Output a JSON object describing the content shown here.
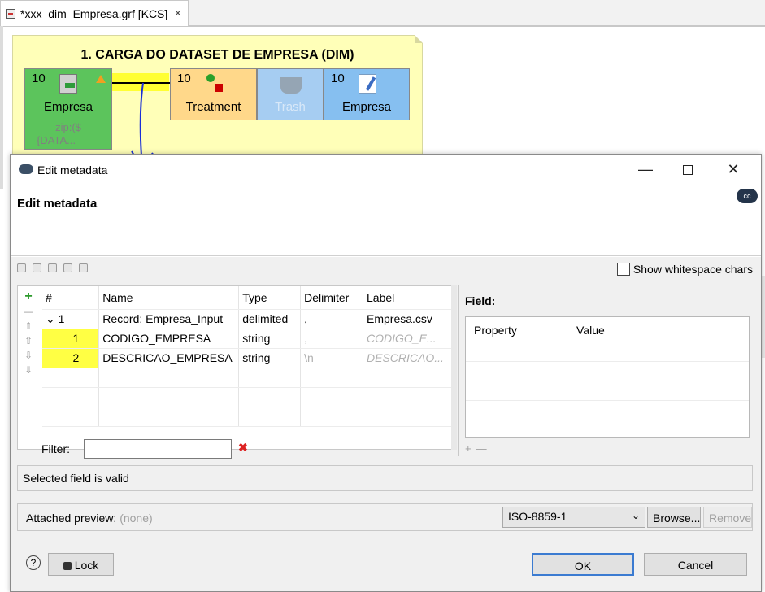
{
  "editor": {
    "tab_title": "*xxx_dim_Empresa.grf [KCS]",
    "tab_close": "✕"
  },
  "graph": {
    "phase_title": "1. CARGA DO DATASET DE EMPRESA (DIM)",
    "nodes": [
      {
        "id": "reader",
        "phase": "10",
        "label": "Empresa",
        "sub1": "zip:($",
        "sub2": "{DATA..."
      },
      {
        "id": "treatment",
        "phase": "10",
        "label": "Treatment"
      },
      {
        "id": "trash",
        "phase": "",
        "label": "Trash"
      },
      {
        "id": "writer",
        "phase": "10",
        "label": "Empresa"
      }
    ]
  },
  "dialog": {
    "window_title": "Edit metadata",
    "header_title": "Edit metadata",
    "header_logo": "cc",
    "whitespace_label": "Show whitespace chars",
    "table": {
      "headers": [
        "#",
        "Name",
        "Type",
        "Delimiter",
        "Label"
      ],
      "record": {
        "num": "1",
        "name": "Record: Empresa_Input",
        "type": "delimited",
        "delimiter": ",",
        "label": "Empresa.csv"
      },
      "fields": [
        {
          "num": "1",
          "name": "CODIGO_EMPRESA",
          "type": "string",
          "delimiter": ",",
          "label": "CODIGO_E..."
        },
        {
          "num": "2",
          "name": "DESCRICAO_EMPRESA",
          "type": "string",
          "delimiter": "\\n",
          "label": "DESCRICAO..."
        }
      ]
    },
    "filter_label": "Filter:",
    "filter_value": "",
    "field_panel": {
      "title": "Field:",
      "headers": [
        "Property",
        "Value"
      ]
    },
    "status": "Selected field is valid",
    "preview": {
      "label": "Attached preview:",
      "value": "(none)",
      "encoding": "ISO-8859-1",
      "browse": "Browse...",
      "remove": "Remove"
    },
    "buttons": {
      "help": "?",
      "lock": "Lock",
      "ok": "OK",
      "cancel": "Cancel"
    }
  }
}
